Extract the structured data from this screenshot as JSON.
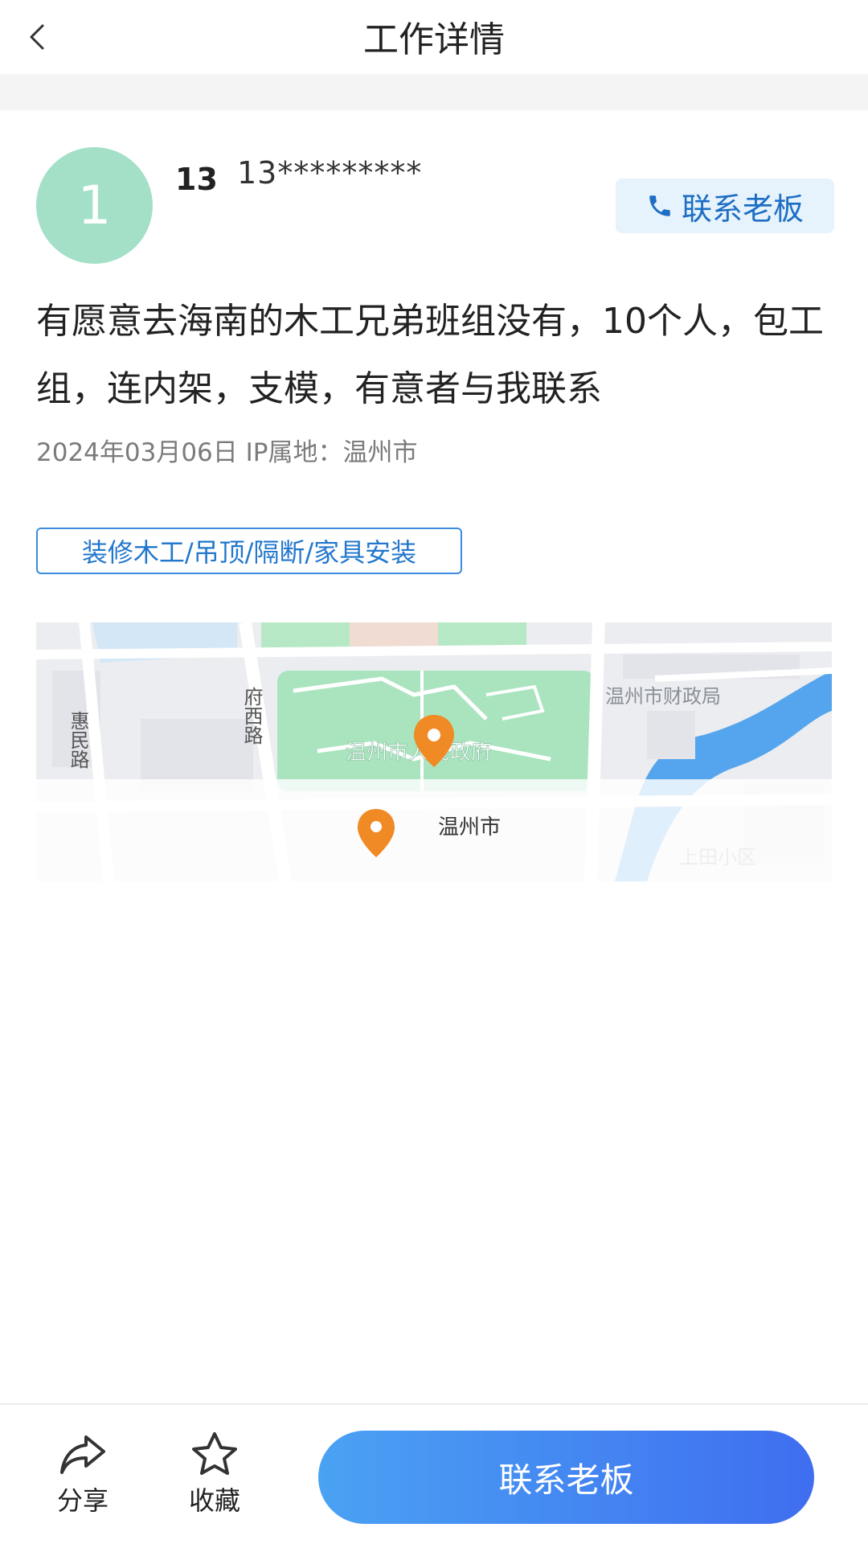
{
  "header": {
    "title": "工作详情"
  },
  "user": {
    "avatar_text": "1",
    "short_name": "13",
    "phone": "13*********",
    "contact_label": "联系老板"
  },
  "post": {
    "description": "有愿意去海南的木工兄弟班组没有，10个人，包工组，连内架，支模，有意者与我联系",
    "date": "2024年03月06日",
    "ip_location": "IP属地：温州市",
    "tag": "装修木工/吊顶/隔断/家具安装"
  },
  "map": {
    "labels": {
      "government": "温州市人民政府",
      "finance_bureau": "温州市财政局",
      "road_fuxi": "府西路",
      "road_huimin": "惠民路",
      "city": "温州市",
      "district": "上田小区"
    }
  },
  "bottom_bar": {
    "share_label": "分享",
    "favorite_label": "收藏",
    "contact_label": "联系老板"
  },
  "colors": {
    "accent": "#1d6ec4",
    "avatar": "#a3e0c7",
    "button_gradient_start": "#4aa2f3",
    "button_gradient_end": "#3f6ef0",
    "map_pin": "#f08a24"
  }
}
